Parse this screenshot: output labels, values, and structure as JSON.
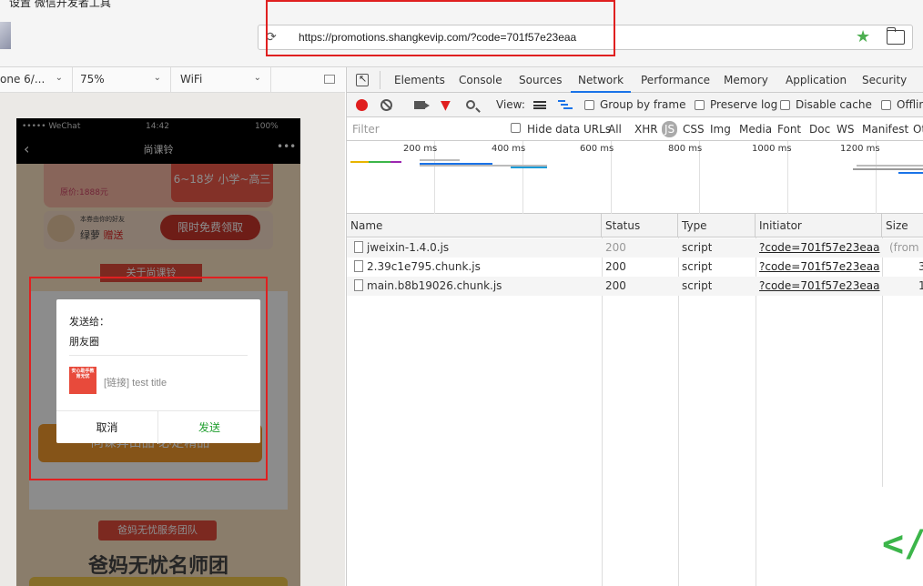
{
  "window": {
    "title": "设置 微信开发者工具"
  },
  "address_bar": {
    "url": "https://promotions.shangkevip.com/?code=701f57e23eaa"
  },
  "simulator": {
    "device": "one 6/...",
    "zoom": "75%",
    "network": "WiFi",
    "status_carrier": "••••• WeChat",
    "status_time": "14:42",
    "status_battery": "100%",
    "page_title": "尚课铃",
    "page": {
      "coupon_text": "6~18岁 小学~高三",
      "price_text": "原价:1888元",
      "gift_line": "本券由你的好友",
      "gift_name": "绿萝",
      "gift_word": "赠送",
      "claim_button": "限时免费领取",
      "about_tag": "关于尚课铃",
      "banner_text": "同课异由品  必定精品",
      "team_tag": "爸妈无忧服务团队",
      "team_title": "爸妈无忧名师团"
    },
    "dialog": {
      "label": "发送给：",
      "target": "朋友圈",
      "thumb_text": "安心助手教育无忧",
      "link_text": "[链接] test title",
      "cancel": "取消",
      "send": "发送"
    }
  },
  "devtools": {
    "tabs": [
      "Elements",
      "Console",
      "Sources",
      "Network",
      "Performance",
      "Memory",
      "Application",
      "Security"
    ],
    "active_tab": "Network",
    "toolbar": {
      "view_label": "View:",
      "group_by_frame": "Group by frame",
      "preserve_log": "Preserve log",
      "disable_cache": "Disable cache",
      "offline": "Offlin"
    },
    "filter": {
      "placeholder": "Filter",
      "hide_data_urls": "Hide data URLs",
      "types": [
        "All",
        "XHR",
        "JS",
        "CSS",
        "Img",
        "Media",
        "Font",
        "Doc",
        "WS",
        "Manifest",
        "Ot"
      ],
      "active_type": "JS"
    },
    "timeline_labels": [
      "200 ms",
      "400 ms",
      "600 ms",
      "800 ms",
      "1000 ms",
      "1200 ms"
    ],
    "columns": [
      "Name",
      "Status",
      "Type",
      "Initiator",
      "Size"
    ],
    "rows": [
      {
        "name": "jweixin-1.4.0.js",
        "status": "200",
        "type": "script",
        "initiator": "?code=701f57e23eaa",
        "size": "(from d"
      },
      {
        "name": "2.39c1e795.chunk.js",
        "status": "200",
        "type": "script",
        "initiator": "?code=701f57e23eaa",
        "size": "3"
      },
      {
        "name": "main.b8b19026.chunk.js",
        "status": "200",
        "type": "script",
        "initiator": "?code=701f57e23eaa",
        "size": "1"
      }
    ]
  }
}
